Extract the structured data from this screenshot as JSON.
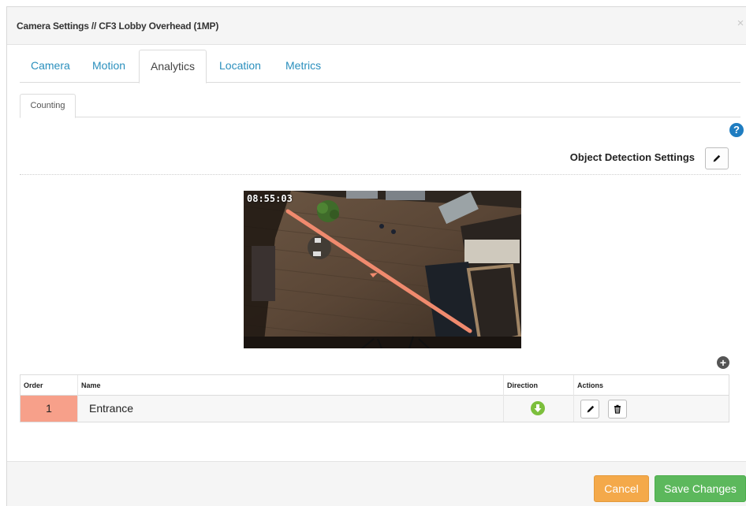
{
  "modal": {
    "title": "Camera Settings // CF3 Lobby Overhead (1MP)",
    "close_glyph": "×"
  },
  "tabs": [
    {
      "label": "Camera"
    },
    {
      "label": "Motion"
    },
    {
      "label": "Analytics",
      "active": true
    },
    {
      "label": "Location"
    },
    {
      "label": "Metrics"
    }
  ],
  "subtabs": [
    {
      "label": "Counting",
      "active": true
    }
  ],
  "help_icon": {
    "glyph": "?",
    "name": "help-icon"
  },
  "object_detection": {
    "label": "Object Detection Settings",
    "edit_icon": "pencil-icon"
  },
  "camera_feed": {
    "timestamp": "08:55:03",
    "line_color": "#f08a6e"
  },
  "add_icon": {
    "glyph": "+"
  },
  "table": {
    "headers": {
      "order": "Order",
      "name": "Name",
      "direction": "Direction",
      "actions": "Actions"
    },
    "rows": [
      {
        "order": "1",
        "name": "Entrance",
        "direction_icon": "arrow-down-circle-icon",
        "actions": [
          "pencil-icon",
          "trash-icon"
        ]
      }
    ]
  },
  "footer": {
    "cancel_label": "Cancel",
    "save_label": "Save Changes"
  },
  "colors": {
    "link": "#2a8fbd",
    "order_highlight": "#f7a08a",
    "direction_green": "#7cbf3c",
    "cancel": "#f4a94a",
    "save": "#5cb85c",
    "help": "#1f7dc1"
  }
}
